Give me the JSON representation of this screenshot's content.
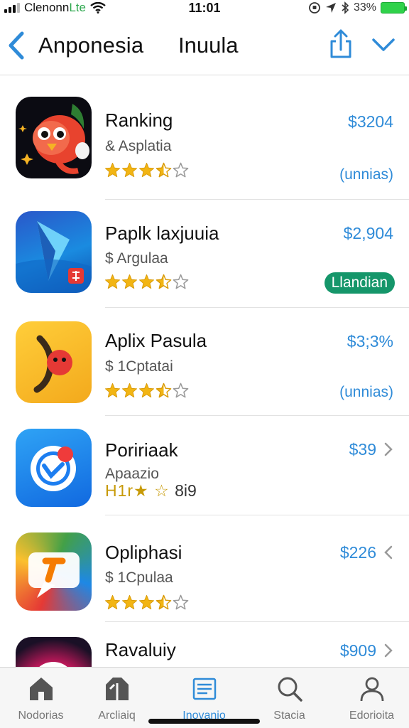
{
  "status_bar": {
    "carrier": "Clenonn",
    "network": "Lte",
    "time": "11:01",
    "battery_percent": "33%"
  },
  "nav": {
    "title": "Anponesia",
    "subtitle": "Inuula",
    "back_icon": "chevron-left-icon",
    "share_icon": "share-icon",
    "more_icon": "chevron-down-icon"
  },
  "colors": {
    "accent": "#2f8bd8",
    "badge_green": "#15966a",
    "star_gold": "#f2b514",
    "battery_green": "#2fd24a"
  },
  "apps": [
    {
      "name": "Ranking",
      "subtitle": "& Asplatia",
      "price": "$3204",
      "rating": 3.5,
      "action": "(unnias)",
      "action_style": "link",
      "chevron": ""
    },
    {
      "name": "Paplk laxjuuia",
      "subtitle": "$ Argulaa",
      "price": "$2,904",
      "rating": 3.5,
      "action": "Llandian",
      "action_style": "badge",
      "chevron": ""
    },
    {
      "name": "Aplix Pasula",
      "subtitle": "$ 1Cptatai",
      "price": "$3;3%",
      "rating": 3.5,
      "action": "(unnias)",
      "action_style": "link",
      "chevron": ""
    },
    {
      "name": "Poririaak",
      "subtitle": "Apaazio",
      "price": "$39",
      "rating_text": "H1r★ ☆",
      "rating_value": "8i9",
      "action": "",
      "action_style": "none",
      "chevron": "right"
    },
    {
      "name": "Opliphasi",
      "subtitle": "$ 1Cpulaa",
      "price": "$226",
      "rating": 3.5,
      "action": "",
      "action_style": "none",
      "chevron": "left"
    },
    {
      "name": "Ravaluiy",
      "subtitle": "",
      "price": "$909",
      "rating": 0,
      "action": "",
      "action_style": "none",
      "chevron": "right"
    }
  ],
  "tabbar": {
    "tabs": [
      {
        "label": "Nodorias",
        "icon": "home-icon",
        "active": false
      },
      {
        "label": "Arcliaiq",
        "icon": "store-icon",
        "active": false
      },
      {
        "label": "Inovanio",
        "icon": "list-icon",
        "active": true
      },
      {
        "label": "Stacia",
        "icon": "search-icon",
        "active": false
      },
      {
        "label": "Edorioita",
        "icon": "person-icon",
        "active": false
      }
    ]
  }
}
